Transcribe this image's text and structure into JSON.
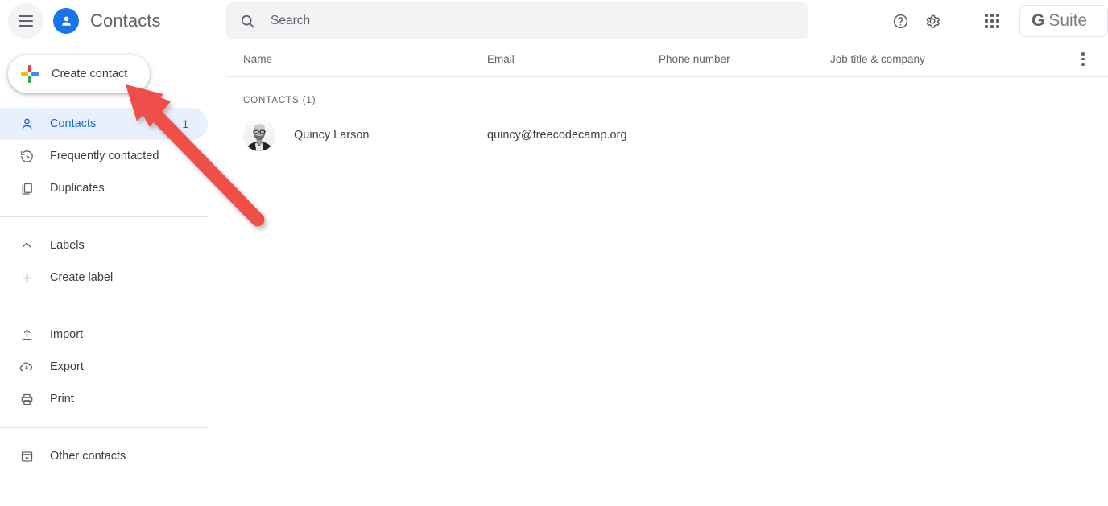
{
  "header": {
    "menu_icon": "hamburger-menu-icon",
    "logo_icon": "person-avatar-icon",
    "title": "Contacts",
    "search": {
      "icon": "search-icon",
      "placeholder": "Search",
      "value": ""
    },
    "actions": [
      {
        "name": "help-button",
        "icon": "help-circle-icon"
      },
      {
        "name": "settings-button",
        "icon": "gear-icon"
      },
      {
        "name": "apps-button",
        "icon": "apps-grid-icon"
      }
    ],
    "account_badge": {
      "g": "G",
      "text": "Suite"
    }
  },
  "sidebar": {
    "create_button": {
      "label": "Create contact",
      "icon": "google-plus-icon"
    },
    "groups": [
      {
        "items": [
          {
            "label": "Contacts",
            "icon": "person-outline-icon",
            "count": "1",
            "active": true
          },
          {
            "label": "Frequently contacted",
            "icon": "history-clock-icon",
            "count": "",
            "active": false
          },
          {
            "label": "Duplicates",
            "icon": "duplicate-pages-icon",
            "count": "",
            "active": false
          }
        ]
      },
      {
        "items": [
          {
            "label": "Labels",
            "icon": "chevron-up-icon",
            "count": "",
            "active": false
          },
          {
            "label": "Create label",
            "icon": "plus-icon",
            "count": "",
            "active": false
          }
        ]
      },
      {
        "items": [
          {
            "label": "Import",
            "icon": "upload-icon",
            "count": "",
            "active": false
          },
          {
            "label": "Export",
            "icon": "cloud-download-icon",
            "count": "",
            "active": false
          },
          {
            "label": "Print",
            "icon": "printer-icon",
            "count": "",
            "active": false
          }
        ]
      },
      {
        "items": [
          {
            "label": "Other contacts",
            "icon": "archive-box-icon",
            "count": "",
            "active": false
          }
        ]
      }
    ]
  },
  "main": {
    "columns": {
      "name": "Name",
      "email": "Email",
      "phone": "Phone number",
      "job": "Job title & company"
    },
    "more_options_icon": "more-vertical-icon",
    "section_label": "CONTACTS (1)",
    "rows": [
      {
        "avatar": "contact-photo",
        "name": "Quincy Larson",
        "email": "quincy@freecodecamp.org",
        "phone": "",
        "job": ""
      }
    ]
  },
  "annotation": {
    "type": "arrow",
    "color": "#f0504a",
    "points_to": "create-contact-button"
  },
  "colors": {
    "accent": "#1a73e8",
    "active_pill": "#e8f0fe",
    "active_text": "#1967d2",
    "text_primary": "#3c4043",
    "text_secondary": "#5f6368",
    "search_bg": "#f1f3f4",
    "annotation": "#f0504a"
  }
}
